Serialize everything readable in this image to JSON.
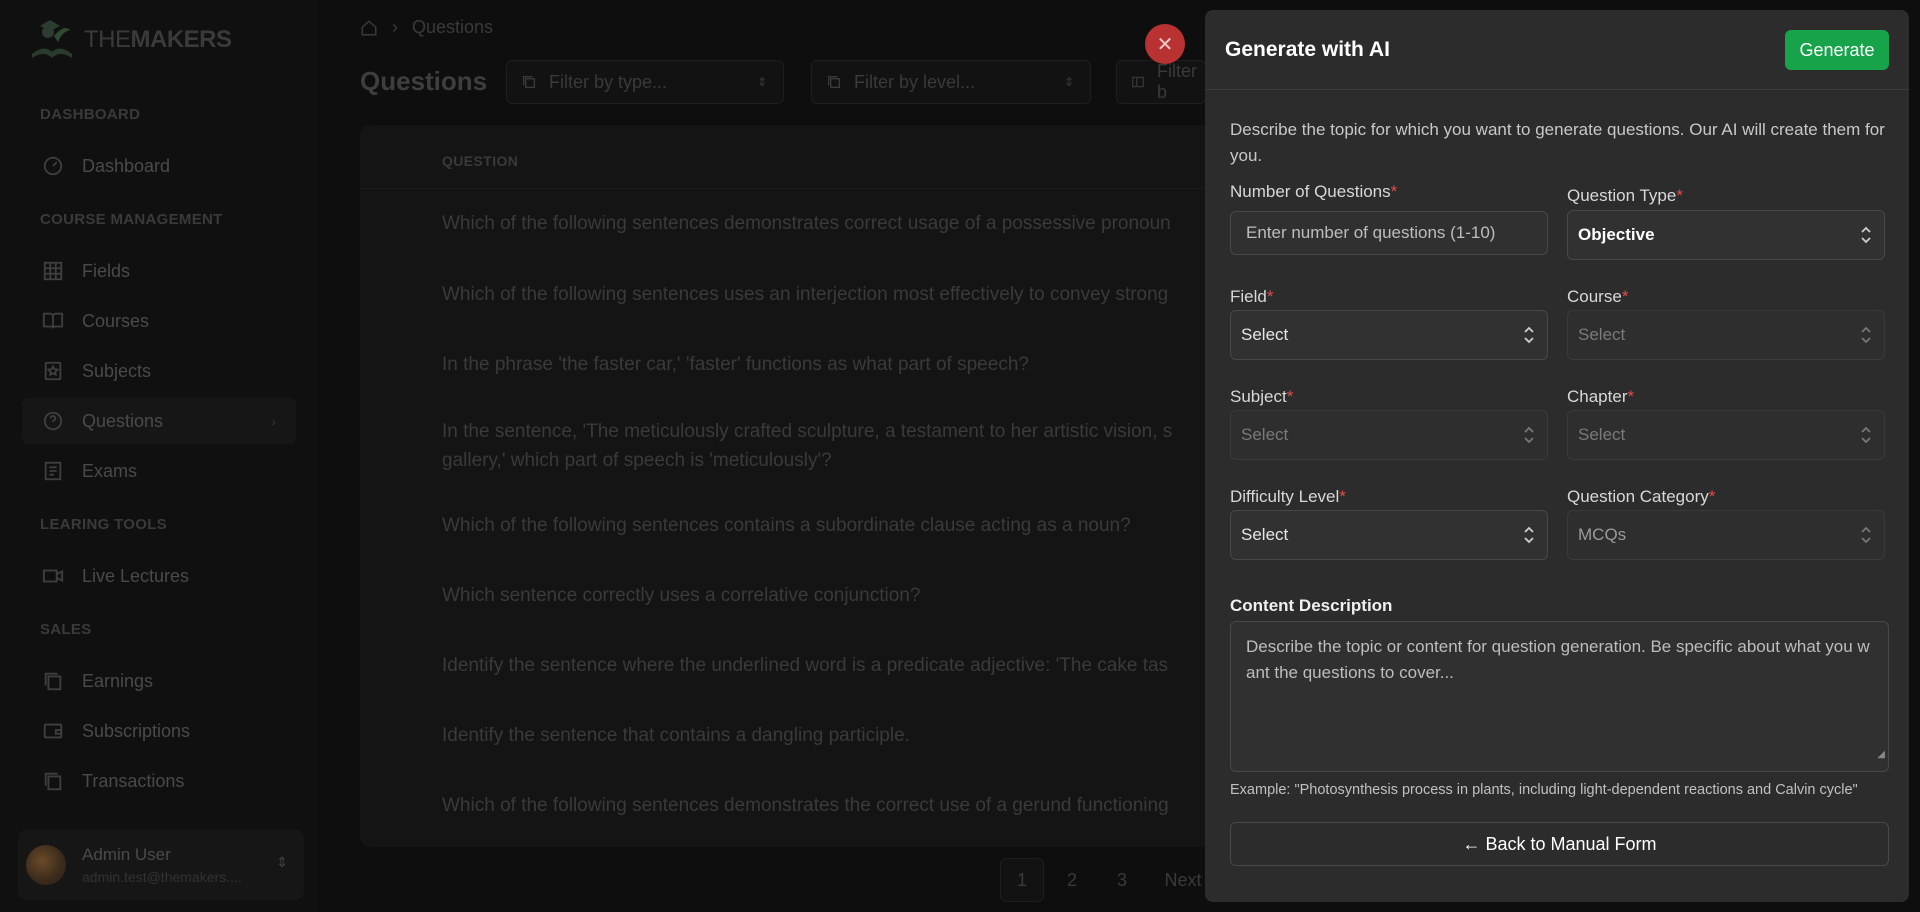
{
  "brand": {
    "prefix": "THE",
    "name": "MAKERS"
  },
  "sidebar": {
    "sections": [
      {
        "title": "DASHBOARD"
      },
      {
        "title": "COURSE MANAGEMENT"
      },
      {
        "title": "LEARING TOOLS"
      },
      {
        "title": "SALES"
      }
    ],
    "items": [
      {
        "label": "Dashboard",
        "icon": "gauge-icon"
      },
      {
        "label": "Fields",
        "icon": "grid-icon"
      },
      {
        "label": "Courses",
        "icon": "book-open-icon"
      },
      {
        "label": "Subjects",
        "icon": "bookmark-icon"
      },
      {
        "label": "Questions",
        "icon": "help-circle-icon",
        "active": true
      },
      {
        "label": "Exams",
        "icon": "document-icon"
      },
      {
        "label": "Live Lectures",
        "icon": "video-icon"
      },
      {
        "label": "Earnings",
        "icon": "copy-icon"
      },
      {
        "label": "Subscriptions",
        "icon": "wallet-icon"
      },
      {
        "label": "Transactions",
        "icon": "copy-icon"
      }
    ],
    "user": {
      "name": "Admin User",
      "email": "admin.test@themakers...."
    }
  },
  "main": {
    "breadcrumb": "Questions",
    "title": "Questions",
    "filters": {
      "type_placeholder": "Filter by type...",
      "level_placeholder": "Filter by level...",
      "third_placeholder": "Filter b"
    },
    "table": {
      "header": "QUESTION",
      "rows": [
        "Which of the following sentences demonstrates correct usage of a possessive pronoun",
        "Which of the following sentences uses an interjection most effectively to convey strong",
        "In the phrase 'the faster car,' 'faster' functions as what part of speech?",
        "In the sentence, 'The meticulously crafted sculpture, a testament to her artistic vision, s",
        "gallery,' which part of speech is 'meticulously'?",
        "Which of the following sentences contains a subordinate clause acting as a noun?",
        "Which sentence correctly uses a correlative conjunction?",
        "Identify the sentence where the underlined word is a predicate adjective: 'The cake tas",
        "Identify the sentence that contains a dangling participle.",
        "Which of the following sentences demonstrates the correct use of a gerund functioning"
      ]
    },
    "pagination": {
      "pages": [
        "1",
        "2",
        "3"
      ],
      "next": "Next",
      "current": "1"
    }
  },
  "modal": {
    "title": "Generate with AI",
    "generate_label": "Generate",
    "intro": "Describe the topic for which you want to generate questions. Our AI will create them for you.",
    "fields": {
      "num_questions": {
        "label": "Number of Questions",
        "placeholder": "Enter number of questions (1-10)"
      },
      "question_type": {
        "label": "Question Type",
        "value": "Objective"
      },
      "field": {
        "label": "Field",
        "value": "Select"
      },
      "course": {
        "label": "Course",
        "value": "Select"
      },
      "subject": {
        "label": "Subject",
        "value": "Select"
      },
      "chapter": {
        "label": "Chapter",
        "value": "Select"
      },
      "difficulty": {
        "label": "Difficulty Level",
        "value": "Select"
      },
      "category": {
        "label": "Question Category",
        "value": "MCQs"
      }
    },
    "required_mark": "*",
    "content_label": "Content Description",
    "content_placeholder": "Describe the topic or content for question generation. Be specific about what you want the questions to cover...",
    "example": "Example: \"Photosynthesis process in plants, including light-dependent reactions and Calvin cycle\"",
    "back_label": "← Back to Manual Form",
    "close_glyph": "✕"
  },
  "colors": {
    "accent_green": "#16a34a",
    "close_red": "#b83232",
    "required_red": "#e24b4b"
  }
}
